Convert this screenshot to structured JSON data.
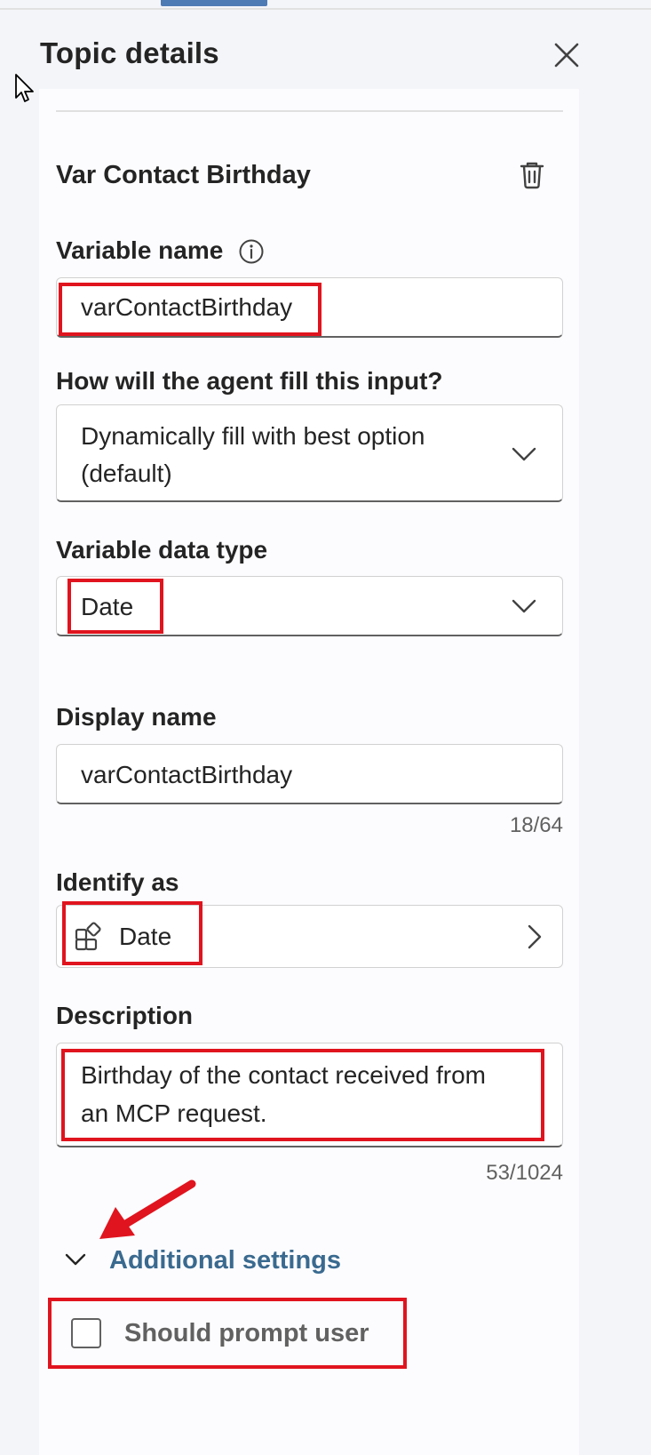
{
  "panel": {
    "title": "Topic details",
    "variable_title": "Var Contact Birthday"
  },
  "fields": {
    "variable_name": {
      "label": "Variable name",
      "value": "varContactBirthday"
    },
    "fill_method": {
      "label": "How will the agent fill this input?",
      "value_line1": "Dynamically fill with best option",
      "value_line2": "(default)"
    },
    "data_type": {
      "label": "Variable data type",
      "value": "Date"
    },
    "display_name": {
      "label": "Display name",
      "value": "varContactBirthday",
      "counter": "18/64"
    },
    "identify_as": {
      "label": "Identify as",
      "value": "Date"
    },
    "description": {
      "label": "Description",
      "value_line1": "Birthday of the contact received from",
      "value_line2": "an MCP request.",
      "counter": "53/1024"
    }
  },
  "additional_settings": {
    "label": "Additional settings",
    "should_prompt_user": {
      "label": "Should prompt user",
      "checked": false
    }
  },
  "icons": {
    "close": "close-icon",
    "delete": "trash-icon",
    "info": "info-icon",
    "chevron": "chevron-down-icon",
    "entity": "entity-shapes-icon",
    "chevron_right": "chevron-right-icon"
  },
  "colors": {
    "highlight": "#e0141e",
    "link": "#3a6a8f",
    "accent_tab": "#4f7bb5"
  }
}
